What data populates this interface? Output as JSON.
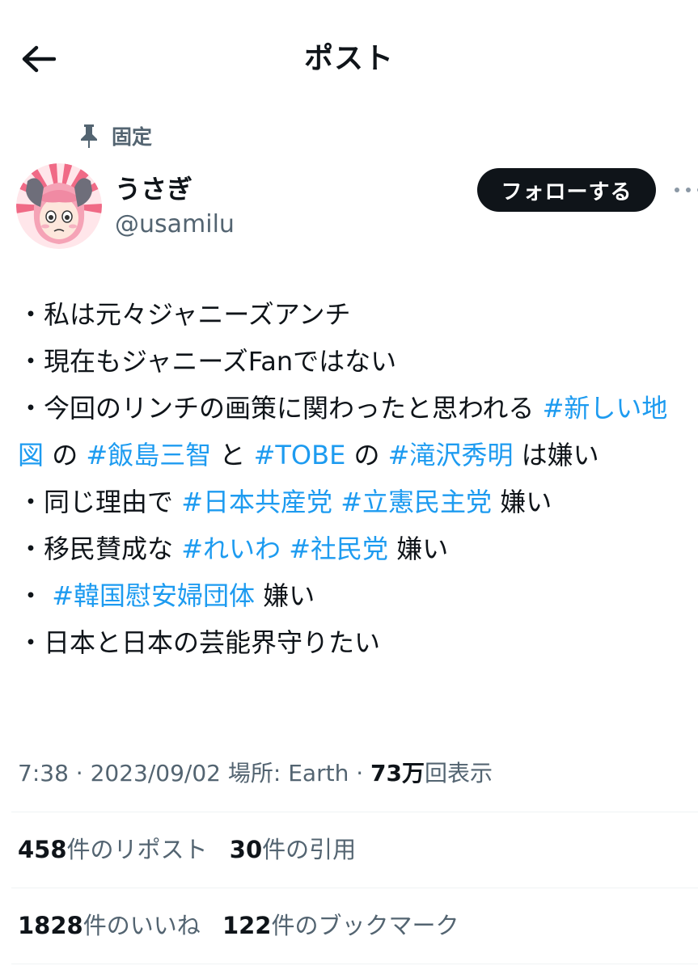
{
  "header": {
    "title": "ポスト"
  },
  "pinned": {
    "label": "固定"
  },
  "user": {
    "name": "うさぎ",
    "handle": "@usamilu",
    "follow_label": "フォローする"
  },
  "post": {
    "lines": [
      {
        "prefix": "・私は元々ジャニーズアンチ"
      },
      {
        "prefix": "・現在もジャニーズFanではない"
      },
      {
        "prefix": "・今回のリンチの画策に関わったと思われる ",
        "tags": [
          "#新しい地図",
          "#飯島三智",
          "#TOBE",
          "#滝沢秀明"
        ],
        "joins": [
          " の ",
          " と ",
          " の ",
          " は嫌い"
        ]
      },
      {
        "prefix": "・同じ理由で ",
        "tags": [
          "#日本共産党",
          "#立憲民主党"
        ],
        "joins": [
          " ",
          " 嫌い"
        ]
      },
      {
        "prefix": "・移民賛成な ",
        "tags": [
          "#れいわ",
          "#社民党"
        ],
        "joins": [
          " ",
          " 嫌い"
        ]
      },
      {
        "prefix": "・ ",
        "tags": [
          "#韓国慰安婦団体"
        ],
        "joins": [
          " 嫌い"
        ]
      },
      {
        "prefix": "・日本と日本の芸能界守りたい"
      }
    ]
  },
  "meta": {
    "time": "7:38",
    "date": "2023/09/02",
    "location": "場所: Earth",
    "views_count": "73万",
    "views_label": "回表示"
  },
  "stats": {
    "reposts_count": "458",
    "reposts_label": "件のリポスト",
    "quotes_count": "30",
    "quotes_label": "件の引用",
    "likes_count": "1828",
    "likes_label": "件のいいね",
    "bookmarks_count": "122",
    "bookmarks_label": "件のブックマーク"
  },
  "colors": {
    "hashtag": "#1d9bf0",
    "text": "#0f1419",
    "secondary": "#536471",
    "follow_bg": "#0f1419"
  },
  "icons": {
    "back": "arrow-left-icon",
    "pin": "pin-icon",
    "more": "more-icon"
  }
}
